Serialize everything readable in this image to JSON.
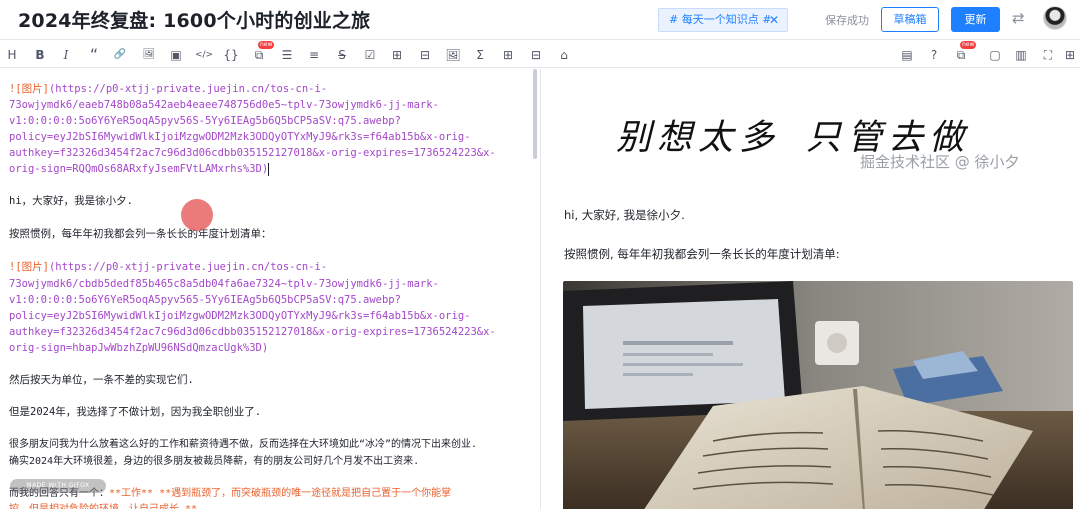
{
  "header": {
    "title": "2024年终复盘: 1600个小时的创业之旅",
    "tag": "# 每天一个知识点 #",
    "tag_close": "✕",
    "save_status": "保存成功",
    "draft_button": "草稿箱",
    "publish_button": "更新",
    "switch_icon": "⇄"
  },
  "toolbar": {
    "heading": "H",
    "bold": "B",
    "italic": "I",
    "quote": "“",
    "link": "🔗",
    "image": "🖼",
    "video": "▣",
    "code": "</>",
    "code_block": "{}",
    "new_badge": "new",
    "list_ul": "☰",
    "list_ol": "≡",
    "strike": "S",
    "task": "☑",
    "table": "⊞",
    "embed": "⧉",
    "formula": "Σ",
    "grid": "⊟",
    "theme": "⌂",
    "right_items": [
      "▤",
      "?",
      "⧉",
      "▢",
      "▥",
      "⛶",
      "⊞"
    ]
  },
  "editor": {
    "lines_block1": [
      "![图片](https://p0-xtjj-private.juejin.cn/tos-cn-i-",
      "73owjymdk6/eaeb748b08a542aeb4eaee748756d0e5~tplv-73owjymdk6-jj-mark-",
      "v1:0:0:0:0:5o6Y6YeR5oqA5pyv56S-5Yy6IEAg5b6Q5bCP5aSV:q75.awebp?",
      "policy=eyJ2bSI6MywidWlkIjoiMzgwODM2Mzk3ODQyOTYxMyJ9&rk3s=f64ab15b&x-orig-",
      "authkey=f32326d3454f2ac7c96d3d06cdbb035152127018&x-orig-expires=1736524223&x-",
      "orig-sign=RQQmOs68ARxfyJsemFVtLAMxrhs%3D)"
    ],
    "greeting": "hi，大家好，我是徐小夕.",
    "intro": "按照惯例，每年年初我都会列一条长长的年度计划清单：",
    "lines_block2": [
      "![图片](https://p0-xtjj-private.juejin.cn/tos-cn-i-",
      "73owjymdk6/cbdb5dedf85b465c8a5db04fa6ae7324~tplv-73owjymdk6-jj-mark-",
      "v1:0:0:0:0:5o6Y6YeR5oqA5pyv565-5Yy6IEAg5b6Q5bCP5aSV:q75.awebp?",
      "policy=eyJ2bSI6MywidWlkIjoiMzgwODM2Mzk3ODQyOTYxMyJ9&rk3s=f64ab15b&x-orig-",
      "authkey=f32326d3454f2ac7c96d3d06cdbb035152127018&x-orig-expires=1736524223&x-",
      "orig-sign=hbapJwWbzhZpWU96NSdQmzacUgk%3D)"
    ],
    "para1": "然后按天为单位，一条不差的实现它们.",
    "para2": "但是2024年，我选择了不做计划，因为我全职创业了.",
    "para3_l1": "很多朋友问我为什么放着这么好的工作和薪资待遇不做，反而选择在大环境如此“冰冷”的情况下出来创业.",
    "para3_l2": "确实2024年大环境很差，身边的很多朋友被裁员降薪，有的朋友公司好几个月发不出工资来.",
    "para4_start": "而我的回答只有一个：",
    "para4_red": "**工作** **遇到瓶颈了，而突破瓶颈的唯一途径就是把自己置于一个你能掌",
    "para4_l2": "控，但是相对危险的环境，让自己成长.**",
    "watermark": "MADE WITH GIFOX"
  },
  "preview": {
    "calligraphy_a": "别想太多",
    "calligraphy_b": "只管去做",
    "site_watermark": "掘金技术社区 @ 徐小夕",
    "greeting": "hi, 大家好, 我是徐小夕.",
    "intro": "按照惯例, 每年年初我都会列一条长长的年度计划清单:"
  }
}
